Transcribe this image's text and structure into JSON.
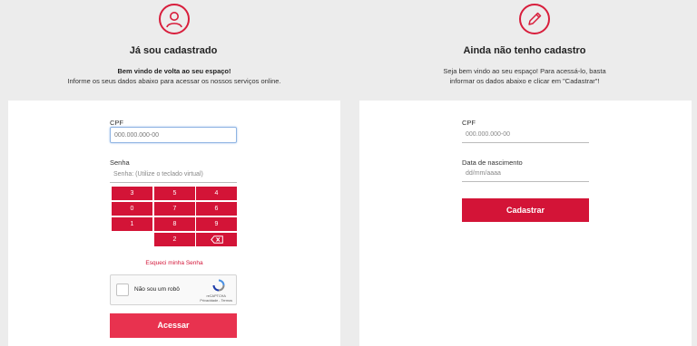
{
  "colors": {
    "accent": "#d31437",
    "button_acessar": "#e8324f",
    "background": "#ececec"
  },
  "login": {
    "icon": "user-icon",
    "title": "Já sou cadastrado",
    "welcome": "Bem vindo de volta ao seu espaço!",
    "instructions": "Informe os seus dados abaixo para acessar os nossos serviços online.",
    "cpf_label": "CPF",
    "cpf_placeholder": "000.000.000-00",
    "senha_label": "Senha",
    "senha_placeholder": "Senha: (Utilize o teclado virtual)",
    "keypad": [
      "3",
      "5",
      "4",
      "0",
      "7",
      "6",
      "1",
      "8",
      "9",
      "2"
    ],
    "backspace_icon": "backspace-icon",
    "forgot": "Esqueci minha Senha",
    "captcha_label": "Não sou um robô",
    "captcha_brand": "reCAPTCHA",
    "captcha_links": "Privacidade - Termos",
    "submit": "Acessar"
  },
  "register": {
    "icon": "pencil-icon",
    "title": "Ainda não tenho cadastro",
    "line1": "Seja bem vindo ao seu espaço! Para acessá-lo, basta",
    "line2": "informar os dados abaixo e clicar em \"Cadastrar\"!",
    "cpf_label": "CPF",
    "cpf_placeholder": "000.000.000-00",
    "dob_label": "Data de nascimento",
    "dob_placeholder": "dd/mm/aaaa",
    "submit": "Cadastrar"
  }
}
